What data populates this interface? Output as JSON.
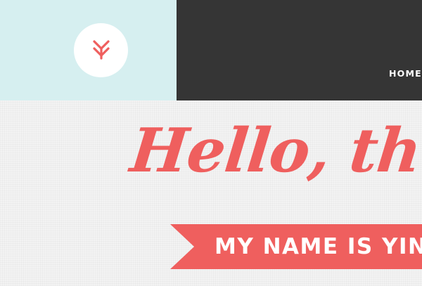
{
  "logo": {
    "icon": "chevron-arrow-down-icon",
    "color": "#ef5f5e",
    "background": "#ffffff"
  },
  "nav": {
    "home_label": "HOME"
  },
  "hero": {
    "greeting": "Hello, th",
    "tagline": "MY NAME IS YIN"
  },
  "colors": {
    "accent": "#ef5f5e",
    "logo_panel": "#d6eff0",
    "nav_panel": "#353535",
    "page_background": "#f3f3f3"
  }
}
